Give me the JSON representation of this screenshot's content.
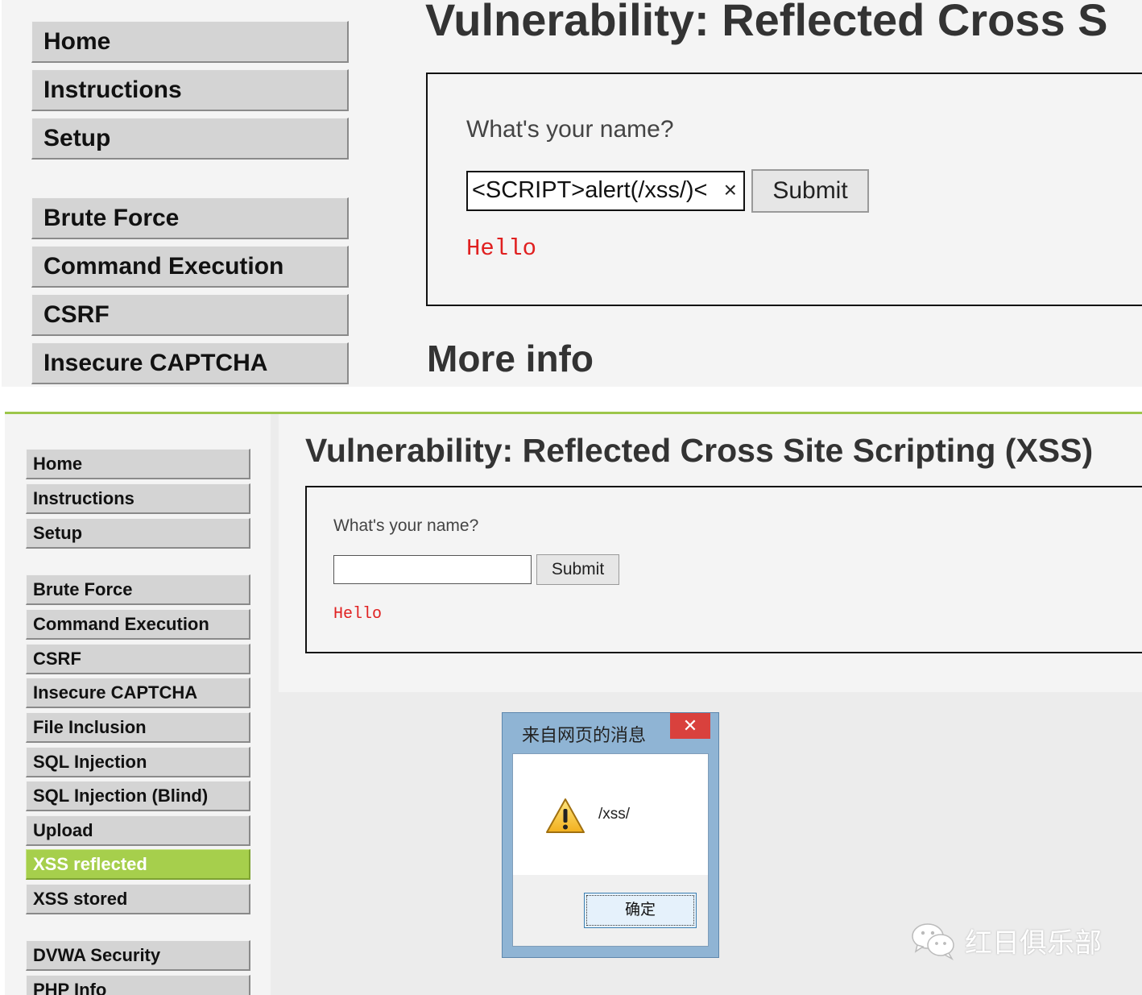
{
  "top_panel": {
    "nav": [
      "Home",
      "Instructions",
      "Setup",
      "Brute Force",
      "Command Execution",
      "CSRF",
      "Insecure CAPTCHA"
    ],
    "title": "Vulnerability: Reflected Cross S",
    "question": "What's your name?",
    "input_value": "<SCRIPT>alert(/xss/)<",
    "clear_glyph": "×",
    "submit_label": "Submit",
    "output": "Hello",
    "more_info": "More info"
  },
  "bottom_panel": {
    "nav": [
      "Home",
      "Instructions",
      "Setup",
      "Brute Force",
      "Command Execution",
      "CSRF",
      "Insecure CAPTCHA",
      "File Inclusion",
      "SQL Injection",
      "SQL Injection (Blind)",
      "Upload",
      "XSS reflected",
      "XSS stored",
      "DVWA Security",
      "PHP Info"
    ],
    "active_nav": "XSS reflected",
    "title": "Vulnerability: Reflected Cross Site Scripting (XSS)",
    "question": "What's your name?",
    "input_value": "",
    "submit_label": "Submit",
    "output": "Hello"
  },
  "alert": {
    "title": "来自网页的消息",
    "close_glyph": "✕",
    "message": "/xss/",
    "ok_label": "确定"
  },
  "watermark": {
    "text": "红日俱乐部"
  },
  "colors": {
    "active_nav": "#a6cf4c",
    "header_rule": "#9cc64a",
    "output_text": "#e02020",
    "dialog_frame": "#8fb4d4",
    "dialog_close": "#d9413d"
  },
  "icons": {
    "alert": "warning-icon",
    "watermark": "wechat-icon"
  }
}
